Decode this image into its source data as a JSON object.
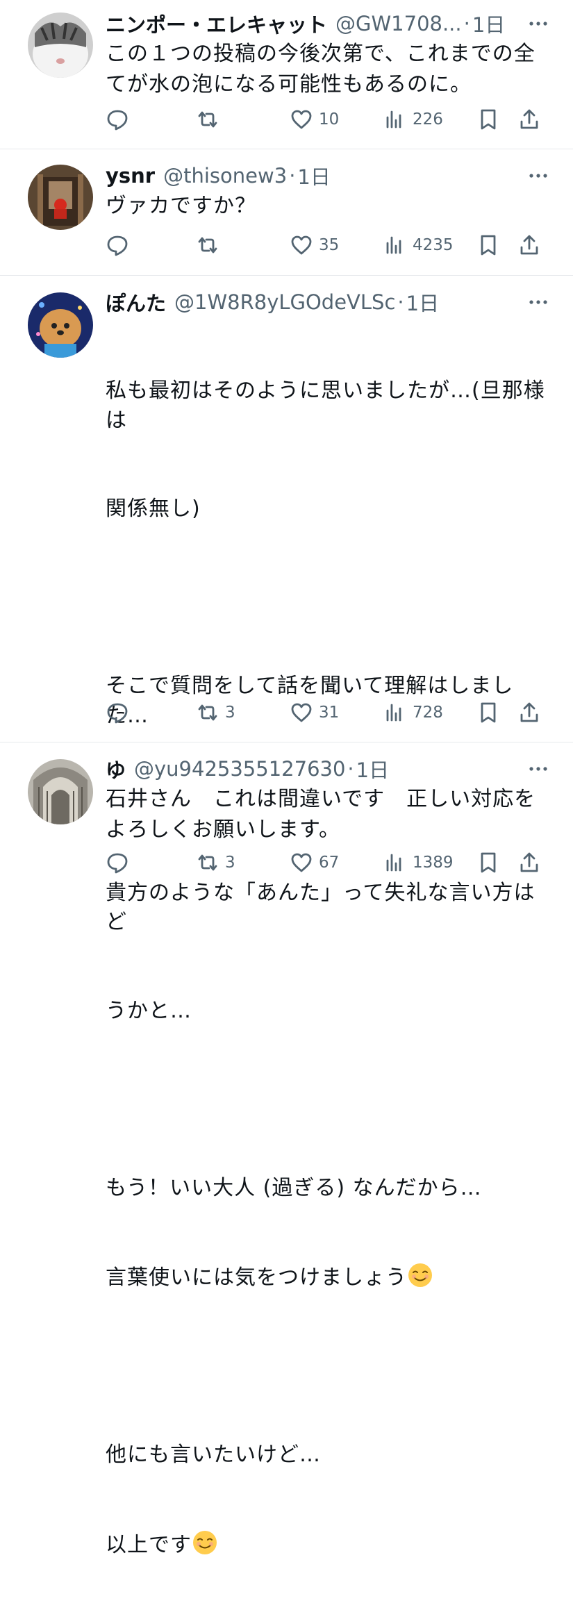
{
  "tweets": [
    {
      "name": "ニンポー・エレキャット",
      "handle": "@GW1708...",
      "time": "1日",
      "text": "この１つの投稿の今後次第で、これまでの全てが水の泡になる可能性もあるのに。",
      "replies": "",
      "retweets": "",
      "likes": "10",
      "views": "226"
    },
    {
      "name": "ysnr",
      "handle": "@thisonew3",
      "time": "1日",
      "text": "ヴァカですか？",
      "replies": "",
      "retweets": "",
      "likes": "35",
      "views": "4235"
    },
    {
      "name": "ぽんた",
      "handle": "@1W8R8yLGOdeVLSc",
      "time": "1日",
      "text_lines": [
        "私も最初はそのように思いましたが…(旦那様は",
        "関係無し)",
        "",
        "そこで質問をして話を聞いて理解はしました…",
        "",
        "貴方のような「あんた」って失礼な言い方はど",
        "うかと…",
        "",
        "もう！いい大人 (過ぎる) なんだから…",
        "言葉使いには気をつけましょう",
        "",
        "他にも言いたいけど…",
        "以上です"
      ],
      "replies": "",
      "retweets": "3",
      "likes": "31",
      "views": "728"
    },
    {
      "name": "ゆ",
      "handle": "@yu9425355127630",
      "time": "1日",
      "text": "石井さん　これは間違いです　正しい対応をよろしくお願いします。",
      "replies": "",
      "retweets": "3",
      "likes": "67",
      "views": "1389"
    }
  ],
  "separator": "·",
  "emoji": "smiling-face-icon"
}
